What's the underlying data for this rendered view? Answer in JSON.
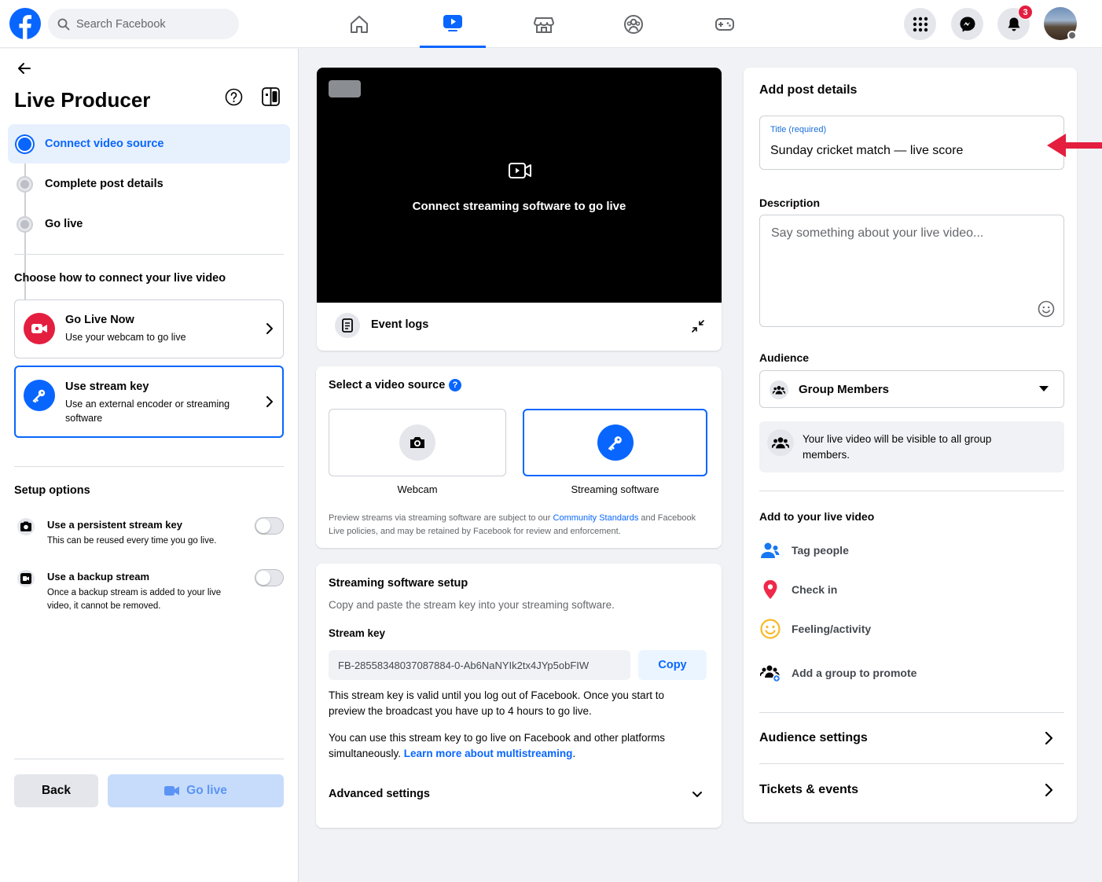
{
  "topbar": {
    "search_placeholder": "Search Facebook",
    "notification_count": "3",
    "nav_tabs": [
      "home",
      "video",
      "marketplace",
      "groups",
      "gaming"
    ],
    "active_tab": "video"
  },
  "left": {
    "title": "Live Producer",
    "steps": [
      {
        "label": "Connect video source",
        "state": "active"
      },
      {
        "label": "Complete post details",
        "state": "pending"
      },
      {
        "label": "Go live",
        "state": "pending"
      }
    ],
    "connect_heading": "Choose how to connect your live video",
    "options": [
      {
        "title": "Go Live Now",
        "desc": "Use your webcam to go live",
        "selected": false
      },
      {
        "title": "Use stream key",
        "desc": "Use an external encoder or streaming software",
        "selected": true
      }
    ],
    "setup_heading": "Setup options",
    "setup": [
      {
        "title": "Use a persistent stream key",
        "desc": "This can be reused every time you go live.",
        "enabled": false
      },
      {
        "title": "Use a backup stream",
        "desc": "Once a backup stream is added to your live video, it cannot be removed.",
        "enabled": false
      }
    ],
    "back_label": "Back",
    "go_live_label": "Go live"
  },
  "center": {
    "preview_message": "Connect streaming software to go live",
    "event_logs_label": "Event logs",
    "select_source_heading": "Select a video source",
    "sources": [
      {
        "label": "Webcam",
        "selected": false
      },
      {
        "label": "Streaming software",
        "selected": true
      }
    ],
    "policy_text_1": "Preview streams via streaming software are subject to our ",
    "policy_link": "Community Standards",
    "policy_text_2": " and Facebook Live policies, and may be retained by Facebook for review and enforcement.",
    "setup_heading": "Streaming software setup",
    "setup_desc": "Copy and paste the stream key into your streaming software.",
    "stream_key_label": "Stream key",
    "stream_key": "FB-28558348037087884-0-Ab6NaNYIk2tx4JYp5obFIW",
    "copy_label": "Copy",
    "validity_text": "This stream key is valid until you log out of Facebook. Once you start to preview the broadcast you have up to 4 hours to go live.",
    "multistream_text": "You can use this stream key to go live on Facebook and other platforms simultaneously. ",
    "multistream_link": "Learn more about multistreaming",
    "multistream_end": ".",
    "advanced_label": "Advanced settings"
  },
  "right": {
    "heading": "Add post details",
    "title_label": "Title (required)",
    "title_value": "Sunday cricket match — live score",
    "description_label": "Description",
    "description_placeholder": "Say something about your live video...",
    "audience_label": "Audience",
    "audience_value": "Group Members",
    "audience_note": "Your live video will be visible to all group members.",
    "add_heading": "Add to your live video",
    "add_items": [
      "Tag people",
      "Check in",
      "Feeling/activity",
      "Add a group to promote"
    ],
    "audience_settings": "Audience settings",
    "tickets_events": "Tickets & events"
  },
  "colors": {
    "accent": "#0866ff",
    "arrow": "#e41e3f"
  }
}
